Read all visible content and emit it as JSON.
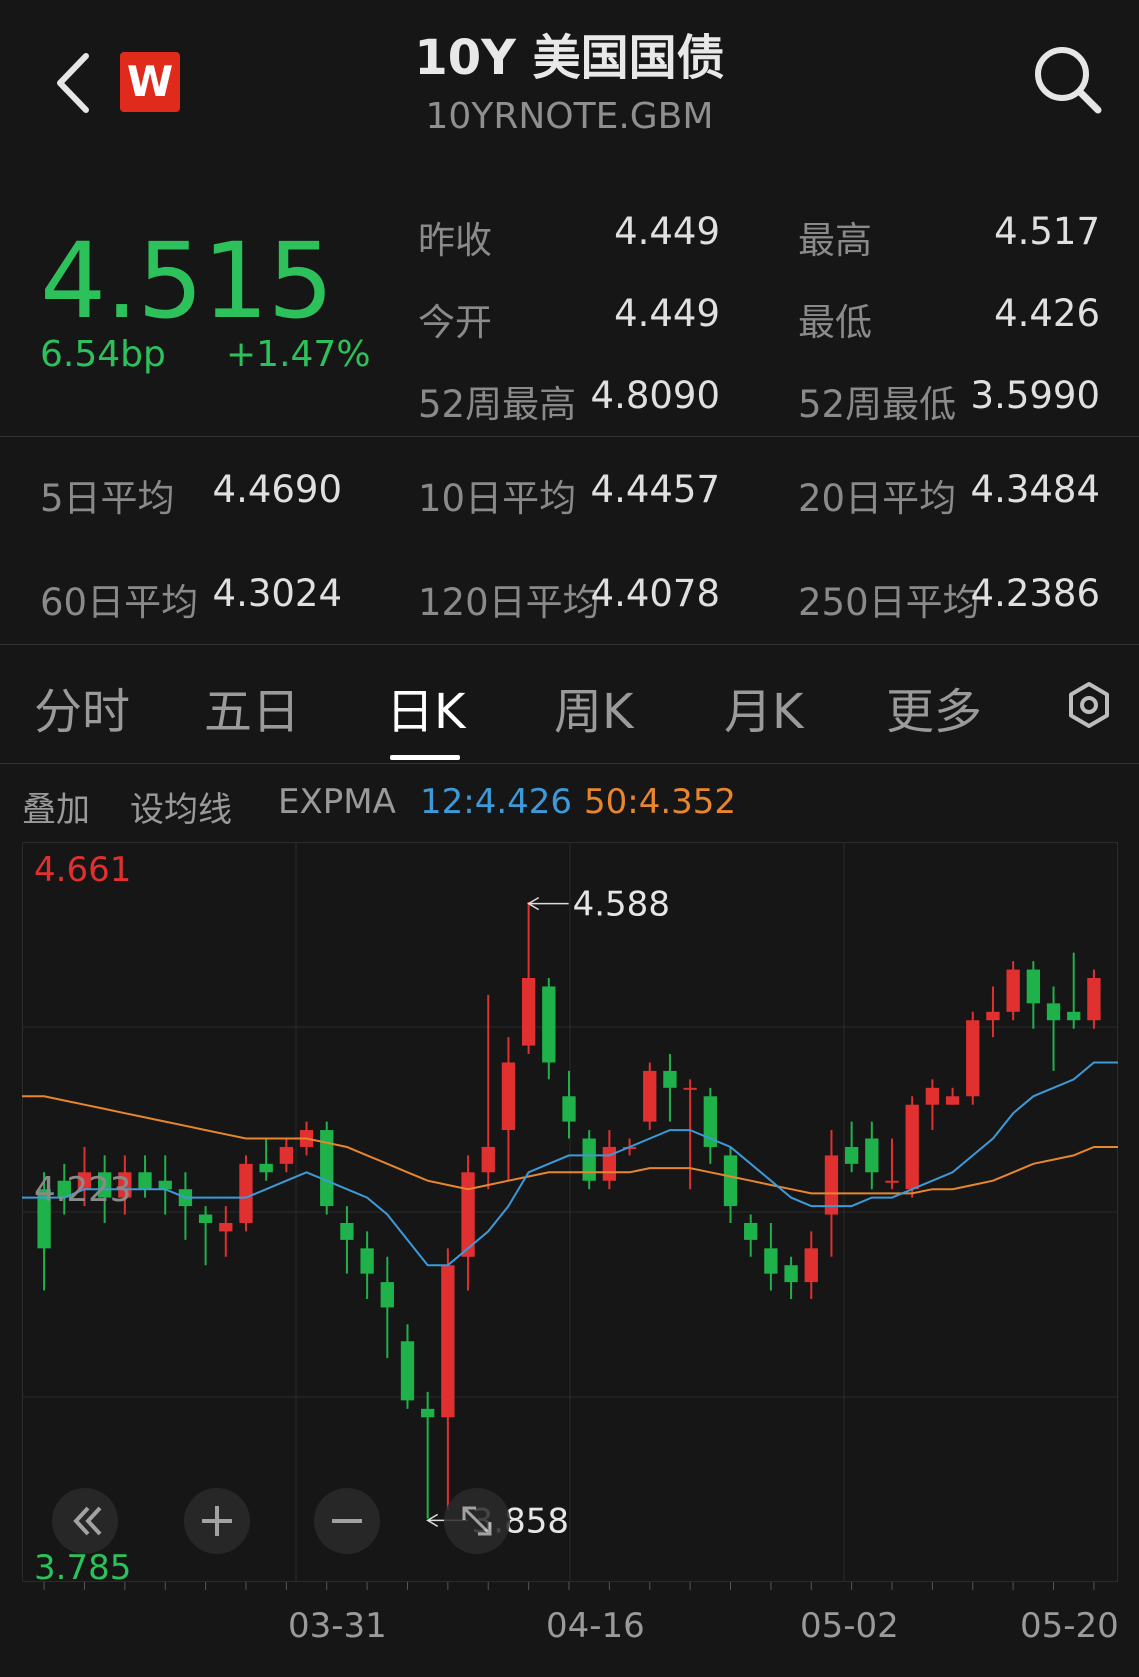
{
  "header": {
    "title": "10Y 美国国债",
    "symbol": "10YRNOTE.GBM",
    "logo_text": "W",
    "icons": {
      "back": "chevron-left-icon",
      "search": "search-icon"
    }
  },
  "quote": {
    "price": "4.515",
    "change_bp": "6.54bp",
    "change_pct": "+1.47%",
    "color_up": "#2cc15a",
    "stats": [
      {
        "label": "昨收",
        "value": "4.449"
      },
      {
        "label": "最高",
        "value": "4.517"
      },
      {
        "label": "今开",
        "value": "4.449"
      },
      {
        "label": "最低",
        "value": "4.426"
      },
      {
        "label": "52周最高",
        "value": "4.8090"
      },
      {
        "label": "52周最低",
        "value": "3.5990"
      }
    ],
    "averages": [
      {
        "label": "5日平均",
        "value": "4.4690"
      },
      {
        "label": "10日平均",
        "value": "4.4457"
      },
      {
        "label": "20日平均",
        "value": "4.3484"
      },
      {
        "label": "60日平均",
        "value": "4.3024"
      },
      {
        "label": "120日平均",
        "value": "4.4078"
      },
      {
        "label": "250日平均",
        "value": "4.2386"
      }
    ]
  },
  "tabs": [
    {
      "label": "分时",
      "active": false
    },
    {
      "label": "五日",
      "active": false
    },
    {
      "label": "日K",
      "active": true
    },
    {
      "label": "周K",
      "active": false
    },
    {
      "label": "月K",
      "active": false
    },
    {
      "label": "更多",
      "active": false
    }
  ],
  "toolbar": {
    "overlay": "叠加",
    "set_ma": "设均线",
    "indicator": "EXPMA",
    "ema12": "12:4.426",
    "ema50": "50:4.352",
    "ema12_color": "#3c9ad8",
    "ema50_color": "#e8862e"
  },
  "chart_data": {
    "type": "candlestick",
    "y_top_label": "4.661",
    "y_mid_label": "4.223",
    "y_bottom_label": "3.785",
    "ylim": [
      3.785,
      4.661
    ],
    "max_annotation": "4.588",
    "min_annotation": "3.858",
    "max_value": 4.588,
    "min_value": 3.858,
    "x_ticks": [
      "03-31",
      "04-16",
      "05-02",
      "05-20"
    ],
    "up_color": "#e03030",
    "down_color": "#1fb14a",
    "candles": [
      [
        4.25,
        4.18,
        4.27,
        4.13
      ],
      [
        4.26,
        4.24,
        4.28,
        4.22
      ],
      [
        4.25,
        4.27,
        4.3,
        4.23
      ],
      [
        4.27,
        4.24,
        4.29,
        4.21
      ],
      [
        4.24,
        4.27,
        4.29,
        4.22
      ],
      [
        4.27,
        4.25,
        4.29,
        4.24
      ],
      [
        4.26,
        4.25,
        4.29,
        4.22
      ],
      [
        4.25,
        4.23,
        4.27,
        4.19
      ],
      [
        4.22,
        4.21,
        4.23,
        4.16
      ],
      [
        4.2,
        4.21,
        4.23,
        4.17
      ],
      [
        4.21,
        4.28,
        4.29,
        4.2
      ],
      [
        4.28,
        4.27,
        4.31,
        4.26
      ],
      [
        4.28,
        4.3,
        4.31,
        4.27
      ],
      [
        4.3,
        4.32,
        4.33,
        4.29
      ],
      [
        4.32,
        4.23,
        4.33,
        4.22
      ],
      [
        4.21,
        4.19,
        4.23,
        4.15
      ],
      [
        4.18,
        4.15,
        4.2,
        4.12
      ],
      [
        4.14,
        4.11,
        4.17,
        4.05
      ],
      [
        4.07,
        4.0,
        4.09,
        3.99
      ],
      [
        3.99,
        3.98,
        4.01,
        3.86
      ],
      [
        3.98,
        4.16,
        4.18,
        3.87
      ],
      [
        4.17,
        4.27,
        4.29,
        4.13
      ],
      [
        4.27,
        4.3,
        4.48,
        4.25
      ],
      [
        4.32,
        4.4,
        4.43,
        4.26
      ],
      [
        4.42,
        4.5,
        4.59,
        4.41
      ],
      [
        4.49,
        4.4,
        4.5,
        4.38
      ],
      [
        4.36,
        4.33,
        4.39,
        4.31
      ],
      [
        4.31,
        4.26,
        4.32,
        4.25
      ],
      [
        4.26,
        4.3,
        4.32,
        4.25
      ],
      [
        4.3,
        4.3,
        4.31,
        4.29
      ],
      [
        4.33,
        4.39,
        4.4,
        4.32
      ],
      [
        4.39,
        4.37,
        4.41,
        4.33
      ],
      [
        4.37,
        4.37,
        4.38,
        4.25
      ],
      [
        4.36,
        4.3,
        4.37,
        4.28
      ],
      [
        4.29,
        4.23,
        4.3,
        4.21
      ],
      [
        4.21,
        4.19,
        4.22,
        4.17
      ],
      [
        4.18,
        4.15,
        4.21,
        4.13
      ],
      [
        4.16,
        4.14,
        4.17,
        4.12
      ],
      [
        4.14,
        4.18,
        4.2,
        4.12
      ],
      [
        4.22,
        4.29,
        4.32,
        4.17
      ],
      [
        4.3,
        4.28,
        4.33,
        4.27
      ],
      [
        4.31,
        4.27,
        4.33,
        4.25
      ],
      [
        4.26,
        4.26,
        4.31,
        4.25
      ],
      [
        4.25,
        4.35,
        4.36,
        4.24
      ],
      [
        4.35,
        4.37,
        4.38,
        4.32
      ],
      [
        4.35,
        4.36,
        4.37,
        4.35
      ],
      [
        4.36,
        4.45,
        4.46,
        4.35
      ],
      [
        4.45,
        4.46,
        4.49,
        4.43
      ],
      [
        4.46,
        4.51,
        4.52,
        4.45
      ],
      [
        4.51,
        4.47,
        4.52,
        4.44
      ],
      [
        4.47,
        4.45,
        4.49,
        4.39
      ],
      [
        4.46,
        4.45,
        4.53,
        4.44
      ],
      [
        4.45,
        4.5,
        4.51,
        4.44
      ]
    ],
    "ema12": [
      4.24,
      4.24,
      4.25,
      4.25,
      4.25,
      4.25,
      4.25,
      4.24,
      4.24,
      4.24,
      4.24,
      4.25,
      4.26,
      4.27,
      4.26,
      4.25,
      4.24,
      4.22,
      4.19,
      4.16,
      4.16,
      4.18,
      4.2,
      4.23,
      4.27,
      4.28,
      4.29,
      4.29,
      4.29,
      4.3,
      4.31,
      4.32,
      4.32,
      4.31,
      4.3,
      4.28,
      4.26,
      4.24,
      4.23,
      4.23,
      4.23,
      4.24,
      4.24,
      4.25,
      4.26,
      4.27,
      4.29,
      4.31,
      4.34,
      4.36,
      4.37,
      4.38,
      4.4
    ],
    "ema50": [
      4.36,
      4.355,
      4.35,
      4.345,
      4.34,
      4.335,
      4.33,
      4.325,
      4.32,
      4.315,
      4.31,
      4.31,
      4.31,
      4.31,
      4.305,
      4.3,
      4.29,
      4.28,
      4.27,
      4.26,
      4.255,
      4.25,
      4.255,
      4.26,
      4.265,
      4.27,
      4.27,
      4.27,
      4.27,
      4.27,
      4.275,
      4.275,
      4.275,
      4.27,
      4.265,
      4.26,
      4.255,
      4.25,
      4.245,
      4.245,
      4.245,
      4.245,
      4.245,
      4.245,
      4.25,
      4.25,
      4.255,
      4.26,
      4.27,
      4.28,
      4.285,
      4.29,
      4.3
    ]
  },
  "chart_controls": {
    "icons": [
      "double-chevron-left-icon",
      "zoom-in-icon",
      "zoom-out-icon",
      "fullscreen-icon"
    ]
  },
  "settings_icon": "settings-icon"
}
